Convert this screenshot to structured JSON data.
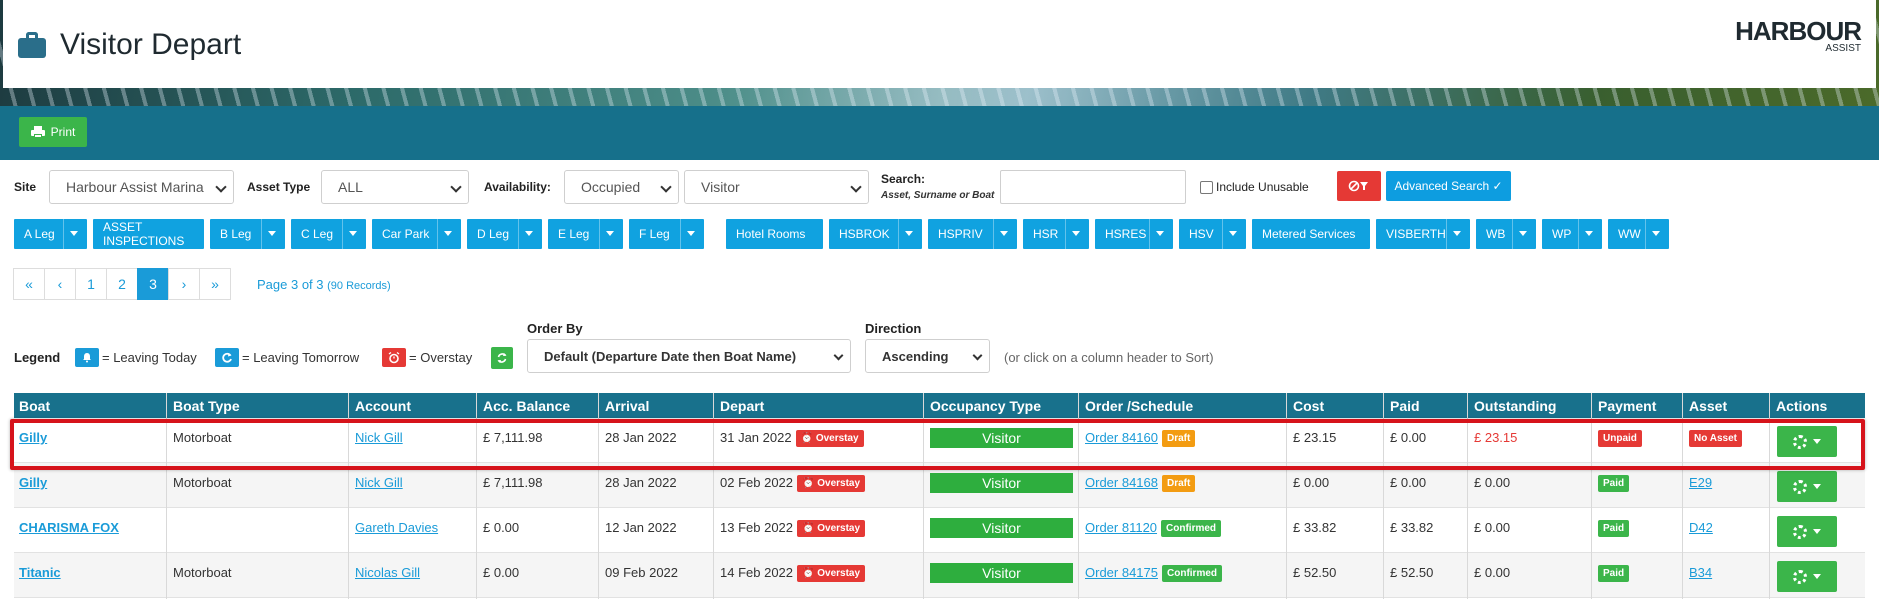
{
  "header": {
    "title": "Visitor Depart",
    "logo_main": "HARBOUR",
    "logo_sub": "ASSIST"
  },
  "toolbar": {
    "print_label": "Print"
  },
  "filters": {
    "site_label": "Site",
    "site_value": "Harbour Assist Marina",
    "asset_type_label": "Asset Type",
    "asset_type_value": "ALL",
    "availability_label": "Availability:",
    "availability_value": "Occupied",
    "visitor_value": "Visitor",
    "search_label": "Search:",
    "search_sub": "Asset, Surname or Boat",
    "search_value": "",
    "include_unusable_label": "Include Unusable",
    "advanced_search_label": "Advanced Search ✓"
  },
  "legs": [
    {
      "label": "A Leg",
      "dropdown": true
    },
    {
      "label": "ASSET INSPECTIONS",
      "dropdown": false
    },
    {
      "label": "B Leg",
      "dropdown": true
    },
    {
      "label": "C Leg",
      "dropdown": true
    },
    {
      "label": "Car Park",
      "dropdown": true
    },
    {
      "label": "D Leg",
      "dropdown": true
    },
    {
      "label": "E Leg",
      "dropdown": true
    },
    {
      "label": "F Leg",
      "dropdown": true
    },
    {
      "label": "Hotel Rooms",
      "dropdown": false
    },
    {
      "label": "HSBROK",
      "dropdown": true
    },
    {
      "label": "HSPRIV",
      "dropdown": true
    },
    {
      "label": "HSR",
      "dropdown": true
    },
    {
      "label": "HSRES",
      "dropdown": true
    },
    {
      "label": "HSV",
      "dropdown": true
    },
    {
      "label": "Metered Services",
      "dropdown": false
    },
    {
      "label": "VISBERTH",
      "dropdown": true
    },
    {
      "label": "WB",
      "dropdown": true
    },
    {
      "label": "WP",
      "dropdown": true
    },
    {
      "label": "WW",
      "dropdown": true
    }
  ],
  "pagination": {
    "first": "«",
    "prev": "‹",
    "pages": [
      "1",
      "2",
      "3"
    ],
    "active_page": "3",
    "next": "›",
    "last": "»",
    "info": "Page 3 of 3",
    "records": "(90 Records)"
  },
  "legend": {
    "label": "Legend",
    "leaving_today": "= Leaving Today",
    "leaving_tomorrow": "= Leaving Tomorrow",
    "overstay": "= Overstay"
  },
  "ordering": {
    "order_by_label": "Order By",
    "order_by_value": "Default (Departure Date then Boat Name)",
    "direction_label": "Direction",
    "direction_value": "Ascending",
    "hint": "(or click on a column header to Sort)"
  },
  "table": {
    "columns": [
      "Boat",
      "Boat Type",
      "Account",
      "Acc. Balance",
      "Arrival",
      "Depart",
      "Occupancy Type",
      "Order /Schedule",
      "Cost",
      "Paid",
      "Outstanding",
      "Payment",
      "Asset",
      "Actions"
    ],
    "rows": [
      {
        "boat": "Gilly",
        "boat_type": "Motorboat",
        "account": "Nick Gill",
        "balance": "£ 7,111.98",
        "arrival": "28 Jan 2022",
        "depart": "31 Jan 2022",
        "depart_tag": "Overstay",
        "occupancy": "Visitor",
        "order": "Order 84160",
        "order_status": "Draft",
        "cost": "£ 23.15",
        "paid": "£ 0.00",
        "outstanding": "£ 23.15",
        "payment": "Unpaid",
        "asset": "No Asset"
      },
      {
        "boat": "Gilly",
        "boat_type": "Motorboat",
        "account": "Nick Gill",
        "balance": "£ 7,111.98",
        "arrival": "28 Jan 2022",
        "depart": "02 Feb 2022",
        "depart_tag": "Overstay",
        "occupancy": "Visitor",
        "order": "Order 84168",
        "order_status": "Draft",
        "cost": "£ 0.00",
        "paid": "£ 0.00",
        "outstanding": "£ 0.00",
        "payment": "Paid",
        "asset": "E29"
      },
      {
        "boat": "CHARISMA FOX",
        "boat_type": "",
        "account": "Gareth Davies",
        "balance": "£ 0.00",
        "arrival": "12 Jan 2022",
        "depart": "13 Feb 2022",
        "depart_tag": "Overstay",
        "occupancy": "Visitor",
        "order": "Order 81120",
        "order_status": "Confirmed",
        "cost": "£ 33.82",
        "paid": "£ 33.82",
        "outstanding": "£ 0.00",
        "payment": "Paid",
        "asset": "D42"
      },
      {
        "boat": "Titanic",
        "boat_type": "Motorboat",
        "account": "Nicolas Gill",
        "balance": "£ 0.00",
        "arrival": "09 Feb 2022",
        "depart": "14 Feb 2022",
        "depart_tag": "Overstay",
        "occupancy": "Visitor",
        "order": "Order 84175",
        "order_status": "Confirmed",
        "cost": "£ 52.50",
        "paid": "£ 52.50",
        "outstanding": "£ 0.00",
        "payment": "Paid",
        "asset": "B34"
      }
    ]
  },
  "colors": {
    "band": "#16708b",
    "button_blue": "#10a2e0",
    "green": "#3bb54a",
    "red": "#e53935",
    "orange": "#f39c12",
    "highlight": "#d6131b"
  }
}
